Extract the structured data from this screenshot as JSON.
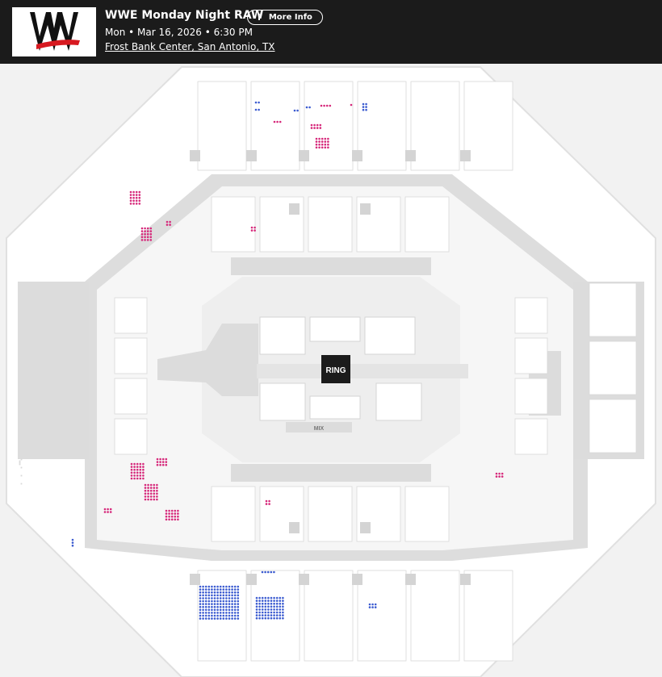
{
  "event": {
    "title": "WWE Monday Night RAW",
    "more_info_label": "More Info",
    "info_glyph": "i",
    "date_line": "Mon • Mar 16, 2026 • 6:30 PM",
    "venue": "Frost Bank Center, San Antonio, TX"
  },
  "map": {
    "ring_label": "RING",
    "mix_label": "MIX",
    "colors": {
      "available_blue": "#3b5bd0",
      "available_pink": "#d6287a",
      "section_fill": "#ffffff",
      "concourse": "#dcdcdc",
      "header_bg": "#1b1b1b",
      "wwe_red": "#d71920"
    }
  }
}
